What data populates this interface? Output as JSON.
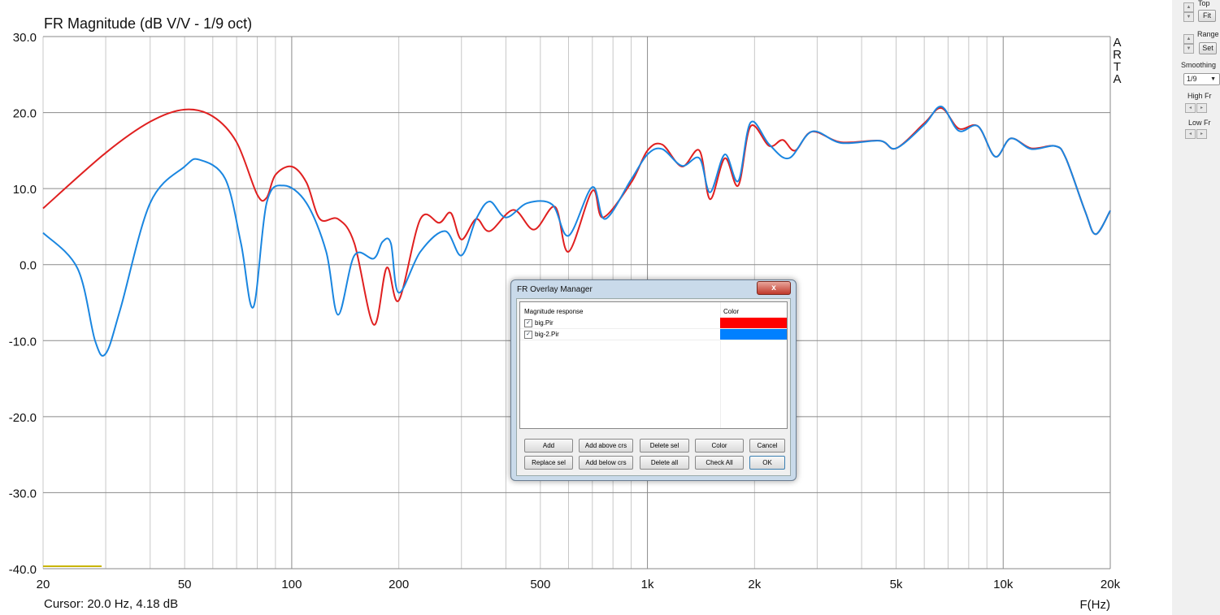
{
  "chart_data": {
    "type": "line",
    "title": "FR Magnitude (dB V/V - 1/9 oct)",
    "xlabel": "F(Hz)",
    "ylabel": "",
    "xscale": "log",
    "xlim": [
      20,
      20000
    ],
    "ylim": [
      -40,
      30
    ],
    "grid": true,
    "x_tick_labels": [
      "20",
      "50",
      "100",
      "200",
      "500",
      "1k",
      "2k",
      "5k",
      "10k",
      "20k"
    ],
    "x_tick_values": [
      20,
      50,
      100,
      200,
      500,
      1000,
      2000,
      5000,
      10000,
      20000
    ],
    "y_tick_labels": [
      "30.0",
      "20.0",
      "10.0",
      "0.0",
      "-10.0",
      "-20.0",
      "-30.0",
      "-40.0"
    ],
    "y_tick_values": [
      30,
      20,
      10,
      0,
      -10,
      -20,
      -30,
      -40
    ],
    "series": [
      {
        "name": "big.Pir",
        "color": "#e02020",
        "x": [
          20,
          30,
          40,
          50,
          60,
          70,
          80,
          85,
          90,
          100,
          110,
          120,
          135,
          150,
          170,
          185,
          200,
          230,
          260,
          280,
          300,
          330,
          360,
          420,
          480,
          550,
          600,
          700,
          750,
          900,
          1000,
          1100,
          1250,
          1400,
          1500,
          1650,
          1800,
          1950,
          2200,
          2400,
          2600,
          2900,
          3500,
          4500,
          5000,
          6000,
          6700,
          7500,
          8500,
          9500,
          10500,
          12000,
          14000,
          15000,
          17000,
          18200,
          20000
        ],
        "y": [
          7.4,
          14.7,
          18.8,
          20.4,
          19.5,
          16.1,
          9.2,
          8.8,
          11.8,
          12.9,
          10.8,
          6,
          6,
          2.8,
          -7.9,
          -0.4,
          -4.7,
          6,
          5.5,
          6.8,
          3.3,
          6,
          4.4,
          7.2,
          4.6,
          7.6,
          1.7,
          9.7,
          6.2,
          10.8,
          15,
          15.8,
          12.9,
          15,
          8.6,
          14,
          10.4,
          18.2,
          15.6,
          16.4,
          15,
          17.5,
          16.1,
          16.3,
          15.3,
          18.6,
          20.6,
          17.9,
          18.2,
          14.2,
          16.6,
          15.3,
          15.6,
          14,
          7,
          4,
          7.1
        ]
      },
      {
        "name": "big-2.Pir",
        "color": "#1a86e0",
        "x": [
          20,
          25,
          28,
          30,
          33,
          40,
          50,
          55,
          65,
          72,
          78,
          85,
          95,
          110,
          125,
          135,
          150,
          170,
          180,
          190,
          200,
          230,
          270,
          300,
          330,
          360,
          400,
          460,
          540,
          600,
          700,
          760,
          900,
          1000,
          1100,
          1250,
          1400,
          1500,
          1650,
          1800,
          1950,
          2200,
          2500,
          2900,
          3500,
          4500,
          5000,
          6000,
          6700,
          7500,
          8500,
          9500,
          10500,
          12000,
          14000,
          15000,
          17000,
          18200,
          20000
        ],
        "y": [
          4.18,
          -0.5,
          -10,
          -11.7,
          -5.8,
          8.1,
          12.9,
          13.8,
          11.3,
          2.8,
          -5.6,
          8.1,
          10.4,
          8.1,
          1.7,
          -6.6,
          1.2,
          0.8,
          3,
          2.8,
          -3.7,
          1.7,
          4.4,
          1.2,
          6,
          8.3,
          6.2,
          8.1,
          7.9,
          3.8,
          10.2,
          6,
          11.2,
          14.5,
          15.2,
          13,
          14,
          9.5,
          14.5,
          11,
          18.7,
          15.8,
          14,
          17.5,
          16,
          16.3,
          15.3,
          18.4,
          20.8,
          17.6,
          18.2,
          14.2,
          16.6,
          15.2,
          15.6,
          14,
          7,
          4,
          7.1
        ]
      }
    ],
    "side_label": "ARTA"
  },
  "cursor_readout": "Cursor: 20.0 Hz, 4.18 dB",
  "side_panel": {
    "top_label": "Top",
    "fit_label": "Fit",
    "range_label": "Range",
    "set_label": "Set",
    "smoothing_label": "Smoothing",
    "smoothing_value": "1/9",
    "high_fr_label": "High Fr",
    "low_fr_label": "Low Fr"
  },
  "dialog": {
    "title": "FR Overlay Manager",
    "close": "x",
    "col_name": "Magnitude response",
    "col_color": "Color",
    "rows": [
      {
        "name": "big.Pir",
        "checked": true,
        "color": "#ff0000"
      },
      {
        "name": "big-2.Pir",
        "checked": true,
        "color": "#0080ff"
      }
    ],
    "buttons": {
      "add": "Add",
      "add_above": "Add above crs",
      "delete_sel": "Delete sel",
      "color": "Color",
      "cancel": "Cancel",
      "replace_sel": "Replace sel",
      "add_below": "Add below crs",
      "delete_all": "Delete all",
      "check_all": "Check All",
      "ok": "OK"
    }
  }
}
